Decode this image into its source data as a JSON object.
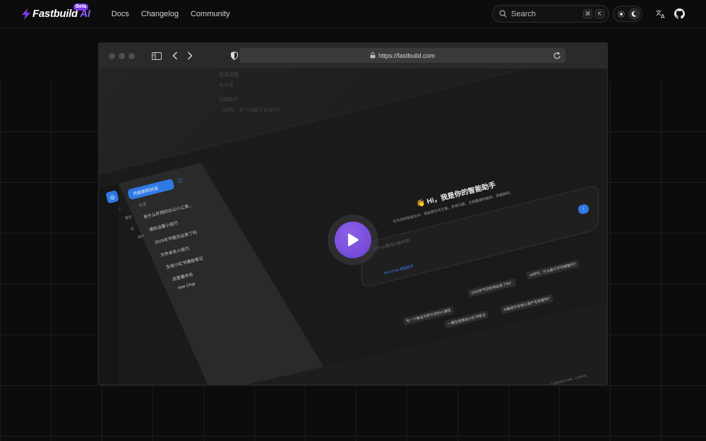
{
  "nav": {
    "logo_main": "Fastbuild",
    "logo_ai": "AI",
    "badge": "Beta",
    "links": [
      "Docs",
      "Changelog",
      "Community"
    ],
    "search_placeholder": "Search",
    "kbd_mod": "⌘",
    "kbd_key": "K"
  },
  "browser": {
    "url": "https://fastbuild.com"
  },
  "app": {
    "top_faded": [
      "登录提醒",
      "命令菜",
      "功能助手",
      "（说明，多个功能可以并行）"
    ],
    "new_chat": "开启新的对话",
    "section_today": "今天",
    "history": [
      "有什么好用的办公小工具...",
      "请你设置小技巧",
      "2025年节假日出来了吗",
      "文件命名小技巧",
      "生成小红书爆款笔记",
      "这里重命名",
      "new Chat"
    ],
    "rail": {
      "home": "首页",
      "user": "用户"
    },
    "hero_title": "👋 Hi，我是你的智能助手",
    "hero_sub": "作为你的智能伙伴，我能帮你写文案、思考问题、文档整理和翻译、答疑解惑。",
    "placeholder": "Hi~有什么想问小助手的",
    "model": "Kimi Chat 智能助手",
    "chips": [
      "写一个像宝可梦方式的小游戏",
      "2025年节日安排出来了吗？",
      "AI时代，什么能力不可被替代?",
      "一键生成微信小红书笔记",
      "AI能成为全球人类产生财富吗?"
    ],
    "footer": "内容由AI生成，无法确保真实准确，仅供参考。"
  },
  "colors": {
    "accent": "#8b5cf6",
    "brand_blue": "#2f7ae5",
    "background": "#0c0c0c"
  }
}
